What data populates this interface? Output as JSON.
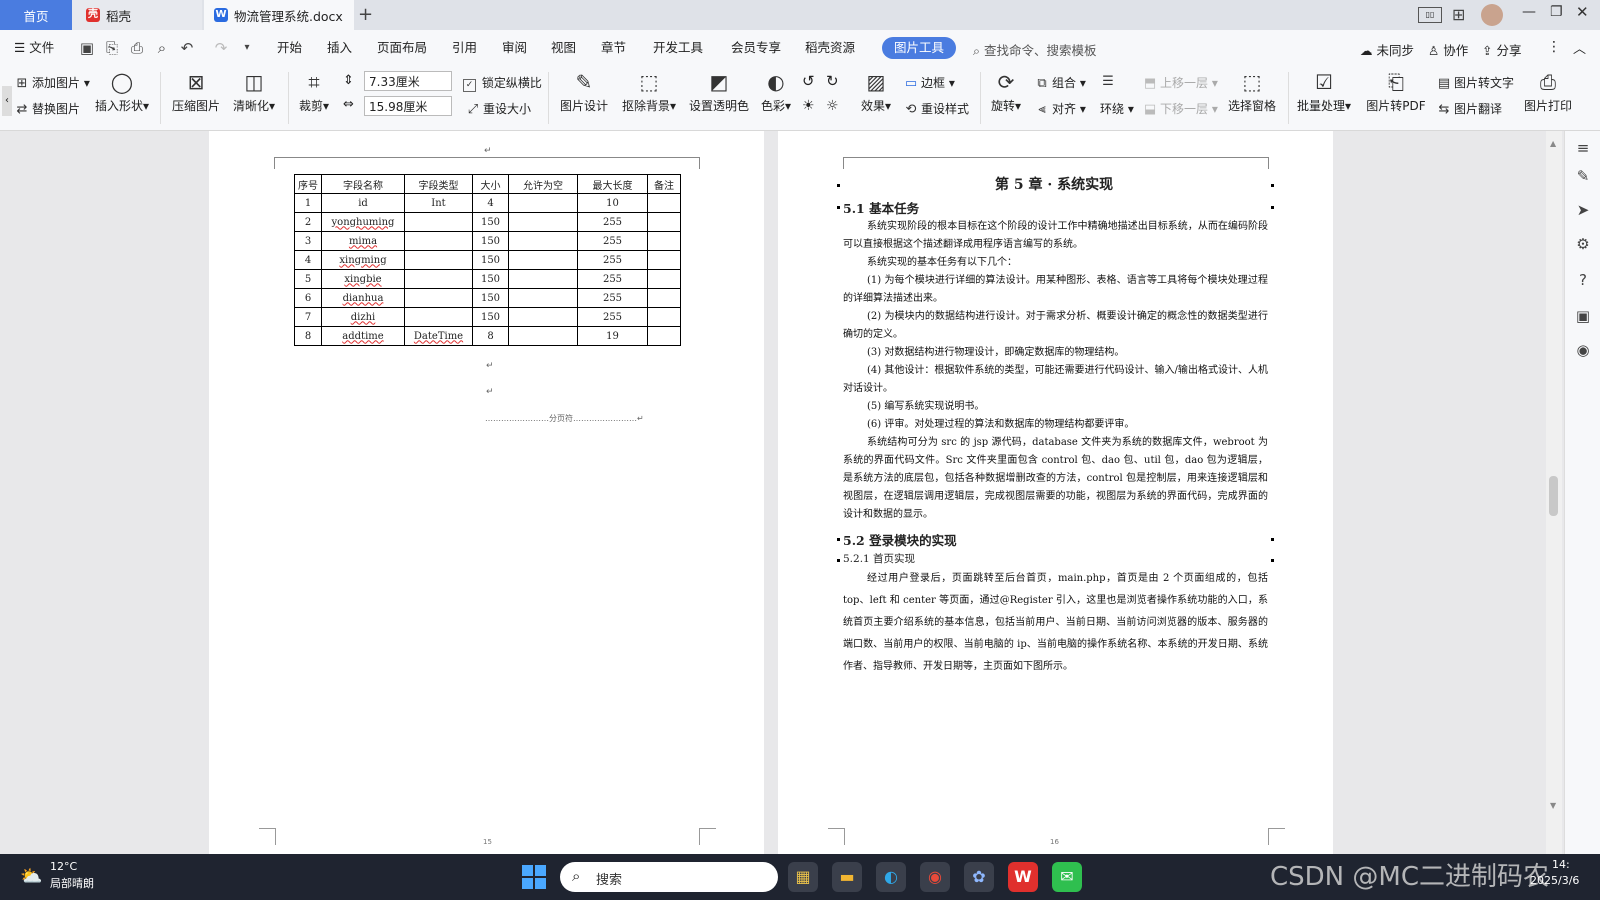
{
  "titlebar": {
    "tabs": [
      {
        "label": "首页"
      },
      {
        "label": "稻壳"
      },
      {
        "label": "物流管理系统.docx"
      }
    ],
    "new_tab": "+",
    "window_controls": [
      "minimize-icon",
      "restore-icon",
      "close-icon"
    ]
  },
  "menubar": {
    "file": "文件",
    "items": [
      "开始",
      "插入",
      "页面布局",
      "引用",
      "审阅",
      "视图",
      "章节",
      "开发工具",
      "会员专享",
      "稻壳资源"
    ],
    "active": "图片工具",
    "search_placeholder": "查找命令、搜索模板",
    "sync": "未同步",
    "collab": "协作",
    "share": "分享"
  },
  "ribbon": {
    "add_image": "添加图片",
    "replace_image": "替换图片",
    "insert_shape": "插入形状",
    "compress": "压缩图片",
    "sharpen": "清晰化",
    "crop": "裁剪",
    "height_value": "7.33厘米",
    "width_value": "15.98厘米",
    "lock_ratio": "锁定纵横比",
    "reset_size": "重设大小",
    "image_design": "图片设计",
    "remove_bg": "抠除背景",
    "transparent": "设置透明色",
    "color": "色彩",
    "effects": "效果",
    "border": "边框",
    "reset_style": "重设样式",
    "rotate": "旋转",
    "group": "组合",
    "align": "对齐",
    "wrap": "环绕",
    "bring_forward": "上移一层",
    "send_backward": "下移一层",
    "selection_pane": "选择窗格",
    "batch": "批量处理",
    "to_pdf": "图片转PDF",
    "to_text": "图片转文字",
    "translate": "图片翻译",
    "print": "图片打印"
  },
  "table": {
    "headers": [
      "序号",
      "字段名称",
      "字段类型",
      "大小",
      "允许为空",
      "最大长度",
      "备注"
    ],
    "rows": [
      [
        "1",
        "id",
        "Int",
        "4",
        "",
        "10",
        ""
      ],
      [
        "2",
        "yonghuming",
        "",
        "150",
        "",
        "255",
        ""
      ],
      [
        "3",
        "mima",
        "",
        "150",
        "",
        "255",
        ""
      ],
      [
        "4",
        "xingming",
        "",
        "150",
        "",
        "255",
        ""
      ],
      [
        "5",
        "xingbie",
        "",
        "150",
        "",
        "255",
        ""
      ],
      [
        "6",
        "dianhua",
        "",
        "150",
        "",
        "255",
        ""
      ],
      [
        "7",
        "dizhi",
        "",
        "150",
        "",
        "255",
        ""
      ],
      [
        "8",
        "addtime",
        "DateTime",
        "8",
        "",
        "19",
        ""
      ]
    ]
  },
  "left_page": {
    "page_break": "分页符",
    "page_number": "15"
  },
  "right_page": {
    "chapter_title": "第 5 章 · 系统实现",
    "sec1": "5.1 基本任务",
    "p1": "系统实现阶段的根本目标在这个阶段的设计工作中精确地描述出目标系统，从而在编码阶段可以直接根据这个描述翻译成用程序语言编写的系统。",
    "p2": "系统实现的基本任务有以下几个：",
    "p3": "(1) 为每个模块进行详细的算法设计。用某种图形、表格、语言等工具将每个模块处理过程的详细算法描述出来。",
    "p4": "(2) 为模块内的数据结构进行设计。对于需求分析、概要设计确定的概念性的数据类型进行确切的定义。",
    "p5": "(3) 对数据结构进行物理设计，即确定数据库的物理结构。",
    "p6": "(4) 其他设计：根据软件系统的类型，可能还需要进行代码设计、输入/输出格式设计、人机对话设计。",
    "p7": "(5) 编写系统实现说明书。",
    "p8": "(6) 评审。对处理过程的算法和数据库的物理结构都要评审。",
    "p9": "系统结构可分为 src 的 jsp 源代码，database 文件夹为系统的数据库文件，webroot 为系统的界面代码文件。Src 文件夹里面包含 control 包、dao 包、util 包，dao 包为逻辑层，是系统方法的底层包，包括各种数据增删改查的方法，control 包是控制层，用来连接逻辑层和视图层，在逻辑层调用逻辑层，完成视图层需要的功能，视图层为系统的界面代码，完成界面的设计和数据的显示。",
    "sec2": "5.2 登录模块的实现",
    "sec21": "5.2.1 首页实现",
    "p10": "经过用户登录后，页面跳转至后台首页，main.php，首页是由 2 个页面组成的，包括 top、left 和 center 等页面，通过@Register 引入，这里也是浏览者操作系统功能的入口，系统首页主要介绍系统的基本信息，包括当前用户、当前日期、当前访问浏览器的版本、服务器的端口数、当前用户的权限、当前电脑的 ip、当前电脑的操作系统名称、本系统的开发日期、系统作者、指导教师、开发日期等，主页面如下图所示。",
    "page_number": "16"
  },
  "taskbar": {
    "weather_temp": "12°C",
    "weather_desc": "局部晴朗",
    "search": "搜索",
    "watermark": "CSDN @MC二进制码农",
    "time": "14:",
    "date": "2025/3/6"
  },
  "colors": {
    "accent": "#4a7ce0",
    "taskbar": "#1f2430",
    "wps_red": "#e0302d"
  }
}
